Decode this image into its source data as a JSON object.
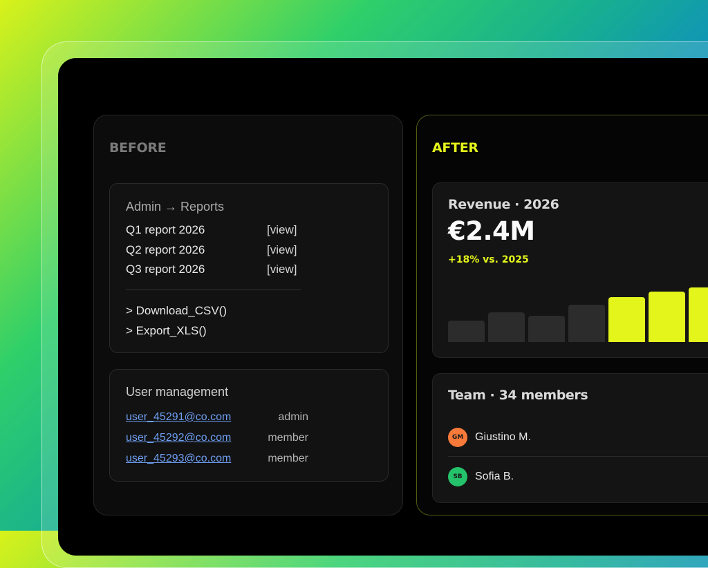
{
  "before": {
    "heading": "BEFORE",
    "reports": {
      "title": "Admin → Reports",
      "rows": [
        {
          "name": "Q1 report 2026",
          "action": "[view]"
        },
        {
          "name": "Q2 report 2026",
          "action": "[view]"
        },
        {
          "name": "Q3 report 2026",
          "action": "[view]"
        }
      ],
      "commands": [
        "> Download_CSV()",
        "> Export_XLS()"
      ]
    },
    "users": {
      "title": "User management",
      "rows": [
        {
          "email": "user_45291@co.com",
          "role": "admin"
        },
        {
          "email": "user_45292@co.com",
          "role": "member"
        },
        {
          "email": "user_45293@co.com",
          "role": "member"
        }
      ]
    }
  },
  "after": {
    "heading": "AFTER",
    "revenue": {
      "label": "Revenue · 2026",
      "value": "€2.4M",
      "change": "+18% vs. 2025",
      "bars": [
        {
          "level": 0.35,
          "highlight": false
        },
        {
          "level": 0.48,
          "highlight": false
        },
        {
          "level": 0.42,
          "highlight": false
        },
        {
          "level": 0.6,
          "highlight": false
        },
        {
          "level": 0.72,
          "highlight": true
        },
        {
          "level": 0.81,
          "highlight": true
        },
        {
          "level": 0.88,
          "highlight": true
        }
      ]
    },
    "team": {
      "label": "Team · 34 members",
      "members": [
        {
          "initials": "GM",
          "name": "Giustino M.",
          "color": "#f77a3a"
        },
        {
          "initials": "SB",
          "name": "Sofia B.",
          "color": "#24c26a"
        }
      ]
    }
  },
  "colors": {
    "accent": "#e4f51c",
    "link": "#6e9ff2"
  }
}
